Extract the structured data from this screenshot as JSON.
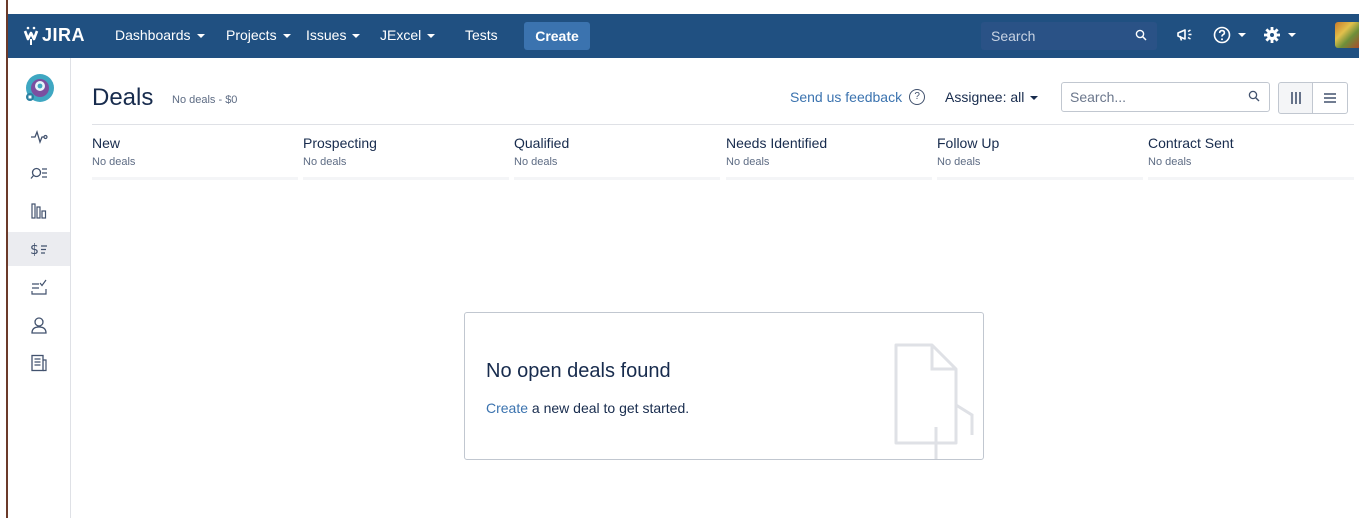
{
  "nav": {
    "logo": "JIRA",
    "items": [
      {
        "label": "Dashboards",
        "caret": true
      },
      {
        "label": "Projects",
        "caret": true
      },
      {
        "label": "Issues",
        "caret": true
      },
      {
        "label": "JExcel",
        "caret": true
      },
      {
        "label": "Tests",
        "caret": false
      }
    ],
    "create_label": "Create",
    "search_placeholder": "Search"
  },
  "header": {
    "title": "Deals",
    "subtitle": "No deals - $0",
    "feedback_label": "Send us feedback",
    "feedback_help": "?",
    "assignee_label": "Assignee: all",
    "search_placeholder": "Search..."
  },
  "columns": [
    {
      "name": "New",
      "count": "No deals"
    },
    {
      "name": "Prospecting",
      "count": "No deals"
    },
    {
      "name": "Qualified",
      "count": "No deals"
    },
    {
      "name": "Needs Identified",
      "count": "No deals"
    },
    {
      "name": "Follow Up",
      "count": "No deals"
    },
    {
      "name": "Contract Sent",
      "count": "No deals"
    }
  ],
  "empty_state": {
    "title": "No open deals found",
    "link_text": "Create",
    "rest_text": " a new deal to get started."
  },
  "colors": {
    "nav_bg": "#205081",
    "create_bg": "#3b73af",
    "link": "#3b73af"
  }
}
